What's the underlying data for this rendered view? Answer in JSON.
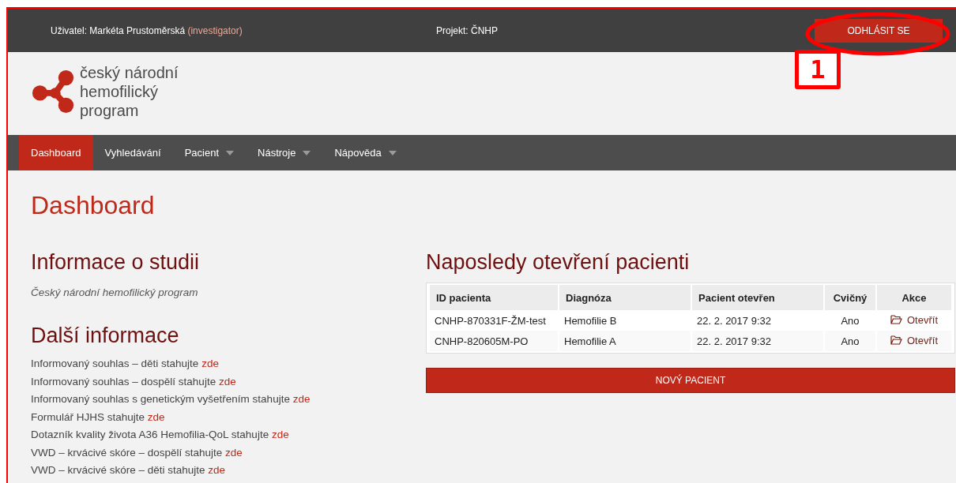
{
  "top_bar": {
    "user_label": "Uživatel:",
    "user_name": "Markéta Prustoměrská",
    "user_role": "(investigator)",
    "project": "Projekt: ČNHP",
    "logout_button": "ODHLÁSIT SE"
  },
  "logo": {
    "lines": [
      "český národní",
      "hemofilický",
      "program"
    ]
  },
  "nav": [
    {
      "label": "Dashboard",
      "selected": true,
      "dropdown": false
    },
    {
      "label": "Vyhledávání",
      "selected": false,
      "dropdown": false
    },
    {
      "label": "Pacient",
      "selected": false,
      "dropdown": true
    },
    {
      "label": "Nástroje",
      "selected": false,
      "dropdown": true
    },
    {
      "label": "Nápověda",
      "selected": false,
      "dropdown": true
    }
  ],
  "page_title": "Dashboard",
  "study": {
    "heading": "Informace o studii",
    "text": "Český národní hemofilický program"
  },
  "more_info": {
    "heading": "Další informace",
    "items": [
      {
        "text": "Informovaný souhlas – děti stahujte",
        "link": "zde"
      },
      {
        "text": "Informovaný souhlas – dospělí stahujte",
        "link": "zde"
      },
      {
        "text": "Informovaný souhlas s genetickým vyšetřením stahujte",
        "link": "zde"
      },
      {
        "text": "Formulář HJHS stahujte",
        "link": "zde"
      },
      {
        "text": "Dotazník kvality života A36 Hemofilia-QoL stahujte",
        "link": "zde"
      },
      {
        "text": "VWD – krvácivé skóre – dospělí stahujte",
        "link": "zde"
      },
      {
        "text": "VWD – krvácivé skóre – děti stahujte",
        "link": "zde"
      }
    ]
  },
  "recent": {
    "heading": "Naposledy otevření pacienti",
    "columns": [
      "ID pacienta",
      "Diagnóza",
      "Pacient otevřen",
      "Cvičný",
      "Akce"
    ],
    "rows": [
      {
        "id": "CNHP-870331F-ŽM-test",
        "diagnosis": "Hemofilie B",
        "opened": "22. 2. 2017 9:32",
        "practice": "Ano",
        "action": "Otevřít"
      },
      {
        "id": "CNHP-820605M-PO",
        "diagnosis": "Hemofilie A",
        "opened": "22. 2. 2017 9:32",
        "practice": "Ano",
        "action": "Otevřít"
      }
    ],
    "new_button": "NOVÝ PACIENT"
  },
  "annotation": {
    "number": "1"
  }
}
